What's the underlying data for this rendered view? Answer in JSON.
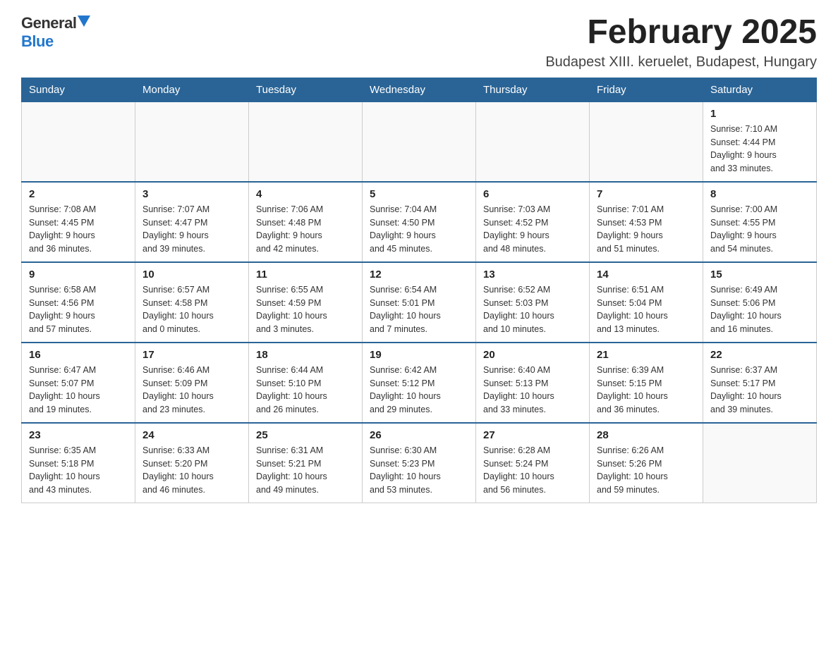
{
  "logo": {
    "general": "General",
    "blue": "Blue"
  },
  "header": {
    "month_year": "February 2025",
    "location": "Budapest XIII. keruelet, Budapest, Hungary"
  },
  "weekdays": [
    "Sunday",
    "Monday",
    "Tuesday",
    "Wednesday",
    "Thursday",
    "Friday",
    "Saturday"
  ],
  "weeks": [
    [
      {
        "day": "",
        "info": ""
      },
      {
        "day": "",
        "info": ""
      },
      {
        "day": "",
        "info": ""
      },
      {
        "day": "",
        "info": ""
      },
      {
        "day": "",
        "info": ""
      },
      {
        "day": "",
        "info": ""
      },
      {
        "day": "1",
        "info": "Sunrise: 7:10 AM\nSunset: 4:44 PM\nDaylight: 9 hours\nand 33 minutes."
      }
    ],
    [
      {
        "day": "2",
        "info": "Sunrise: 7:08 AM\nSunset: 4:45 PM\nDaylight: 9 hours\nand 36 minutes."
      },
      {
        "day": "3",
        "info": "Sunrise: 7:07 AM\nSunset: 4:47 PM\nDaylight: 9 hours\nand 39 minutes."
      },
      {
        "day": "4",
        "info": "Sunrise: 7:06 AM\nSunset: 4:48 PM\nDaylight: 9 hours\nand 42 minutes."
      },
      {
        "day": "5",
        "info": "Sunrise: 7:04 AM\nSunset: 4:50 PM\nDaylight: 9 hours\nand 45 minutes."
      },
      {
        "day": "6",
        "info": "Sunrise: 7:03 AM\nSunset: 4:52 PM\nDaylight: 9 hours\nand 48 minutes."
      },
      {
        "day": "7",
        "info": "Sunrise: 7:01 AM\nSunset: 4:53 PM\nDaylight: 9 hours\nand 51 minutes."
      },
      {
        "day": "8",
        "info": "Sunrise: 7:00 AM\nSunset: 4:55 PM\nDaylight: 9 hours\nand 54 minutes."
      }
    ],
    [
      {
        "day": "9",
        "info": "Sunrise: 6:58 AM\nSunset: 4:56 PM\nDaylight: 9 hours\nand 57 minutes."
      },
      {
        "day": "10",
        "info": "Sunrise: 6:57 AM\nSunset: 4:58 PM\nDaylight: 10 hours\nand 0 minutes."
      },
      {
        "day": "11",
        "info": "Sunrise: 6:55 AM\nSunset: 4:59 PM\nDaylight: 10 hours\nand 3 minutes."
      },
      {
        "day": "12",
        "info": "Sunrise: 6:54 AM\nSunset: 5:01 PM\nDaylight: 10 hours\nand 7 minutes."
      },
      {
        "day": "13",
        "info": "Sunrise: 6:52 AM\nSunset: 5:03 PM\nDaylight: 10 hours\nand 10 minutes."
      },
      {
        "day": "14",
        "info": "Sunrise: 6:51 AM\nSunset: 5:04 PM\nDaylight: 10 hours\nand 13 minutes."
      },
      {
        "day": "15",
        "info": "Sunrise: 6:49 AM\nSunset: 5:06 PM\nDaylight: 10 hours\nand 16 minutes."
      }
    ],
    [
      {
        "day": "16",
        "info": "Sunrise: 6:47 AM\nSunset: 5:07 PM\nDaylight: 10 hours\nand 19 minutes."
      },
      {
        "day": "17",
        "info": "Sunrise: 6:46 AM\nSunset: 5:09 PM\nDaylight: 10 hours\nand 23 minutes."
      },
      {
        "day": "18",
        "info": "Sunrise: 6:44 AM\nSunset: 5:10 PM\nDaylight: 10 hours\nand 26 minutes."
      },
      {
        "day": "19",
        "info": "Sunrise: 6:42 AM\nSunset: 5:12 PM\nDaylight: 10 hours\nand 29 minutes."
      },
      {
        "day": "20",
        "info": "Sunrise: 6:40 AM\nSunset: 5:13 PM\nDaylight: 10 hours\nand 33 minutes."
      },
      {
        "day": "21",
        "info": "Sunrise: 6:39 AM\nSunset: 5:15 PM\nDaylight: 10 hours\nand 36 minutes."
      },
      {
        "day": "22",
        "info": "Sunrise: 6:37 AM\nSunset: 5:17 PM\nDaylight: 10 hours\nand 39 minutes."
      }
    ],
    [
      {
        "day": "23",
        "info": "Sunrise: 6:35 AM\nSunset: 5:18 PM\nDaylight: 10 hours\nand 43 minutes."
      },
      {
        "day": "24",
        "info": "Sunrise: 6:33 AM\nSunset: 5:20 PM\nDaylight: 10 hours\nand 46 minutes."
      },
      {
        "day": "25",
        "info": "Sunrise: 6:31 AM\nSunset: 5:21 PM\nDaylight: 10 hours\nand 49 minutes."
      },
      {
        "day": "26",
        "info": "Sunrise: 6:30 AM\nSunset: 5:23 PM\nDaylight: 10 hours\nand 53 minutes."
      },
      {
        "day": "27",
        "info": "Sunrise: 6:28 AM\nSunset: 5:24 PM\nDaylight: 10 hours\nand 56 minutes."
      },
      {
        "day": "28",
        "info": "Sunrise: 6:26 AM\nSunset: 5:26 PM\nDaylight: 10 hours\nand 59 minutes."
      },
      {
        "day": "",
        "info": ""
      }
    ]
  ]
}
